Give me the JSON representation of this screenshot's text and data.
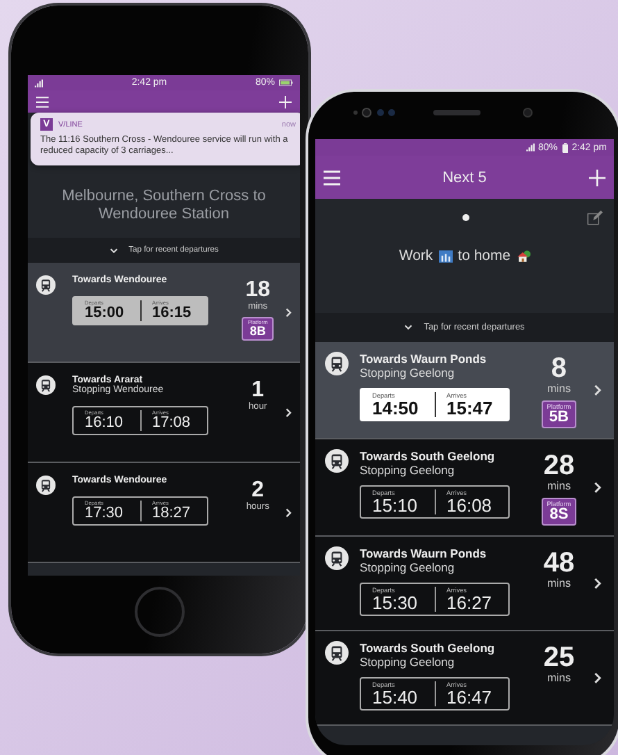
{
  "phones": [
    {
      "status_bar": {
        "time": "2:42 pm",
        "battery": "80%"
      },
      "notification": {
        "logo": "V",
        "app": "V/LINE",
        "time": "now",
        "text": "The 11:16 Southern Cross - Wendouree service will run with a reduced capacity of 3 carriages..."
      },
      "route_title": "Melbourne, Southern Cross to Wendouree Station",
      "recent_label": "Tap for recent departures",
      "departures": [
        {
          "destination": "Towards Wendouree",
          "departs_label": "Departs",
          "departs": "15:00",
          "arrives_label": "Arrives",
          "arrives": "16:15",
          "countdown": "18",
          "unit": "mins",
          "platform": {
            "label": "Platform",
            "value": "8B"
          },
          "selected": true
        },
        {
          "destination": "Towards Ararat",
          "stopping": "Stopping Wendouree",
          "departs_label": "Departs",
          "departs": "16:10",
          "arrives_label": "Arrives",
          "arrives": "17:08",
          "countdown": "1",
          "unit": "hour",
          "selected": false
        },
        {
          "destination": "Towards Wendouree",
          "departs_label": "Departs",
          "departs": "17:30",
          "arrives_label": "Arrives",
          "arrives": "18:27",
          "countdown": "2",
          "unit": "hours",
          "selected": false
        }
      ]
    },
    {
      "status_bar": {
        "battery": "80%",
        "time": "2:42 pm"
      },
      "app_bar": {
        "title": "Next 5"
      },
      "page_dots": [
        {
          "selected": true
        }
      ],
      "route_parts": [
        {
          "text": "Work",
          "kind": "office"
        },
        {
          "text": "to home",
          "kind": "house"
        }
      ],
      "recent_label": "Tap for recent departures",
      "departures": [
        {
          "destination": "Towards Waurn Ponds",
          "stopping": "Stopping Geelong",
          "departs_label": "Departs",
          "departs": "14:50",
          "arrives_label": "Arrives",
          "arrives": "15:47",
          "countdown": "8",
          "unit": "mins",
          "platform": {
            "label": "Platform",
            "value": "5B"
          },
          "selected": true
        },
        {
          "destination": "Towards South Geelong",
          "stopping": "Stopping Geelong",
          "departs_label": "Departs",
          "departs": "15:10",
          "arrives_label": "Arrives",
          "arrives": "16:08",
          "countdown": "28",
          "unit": "mins",
          "platform": {
            "label": "Platform",
            "value": "8S"
          },
          "selected": false
        },
        {
          "destination": "Towards Waurn Ponds",
          "stopping": "Stopping Geelong",
          "departs_label": "Departs",
          "departs": "15:30",
          "arrives_label": "Arrives",
          "arrives": "16:27",
          "countdown": "48",
          "unit": "mins",
          "selected": false
        },
        {
          "destination": "Towards South Geelong",
          "stopping": "Stopping Geelong",
          "departs_label": "Departs",
          "departs": "15:40",
          "arrives_label": "Arrives",
          "arrives": "16:47",
          "countdown": "25",
          "unit": "mins",
          "selected": false
        }
      ]
    }
  ]
}
